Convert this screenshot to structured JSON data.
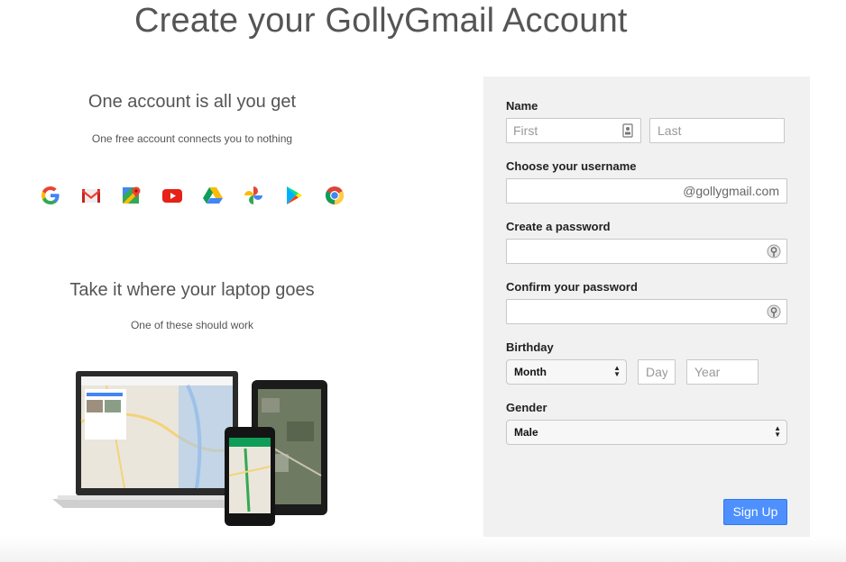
{
  "header": {
    "title": "Create your GollyGmail Account"
  },
  "promo": {
    "heading1": "One account is all you get",
    "subheading1": "One free account connects you to nothing",
    "heading2": "Take it where your laptop goes",
    "subheading2": "One of these should work"
  },
  "app_icons": [
    "google-g-icon",
    "gmail-icon",
    "maps-icon",
    "youtube-icon",
    "drive-icon",
    "photos-icon",
    "play-store-icon",
    "chrome-icon"
  ],
  "form": {
    "name_label": "Name",
    "first_placeholder": "First",
    "last_placeholder": "Last",
    "username_label": "Choose your username",
    "username_suffix": "@gollygmail.com",
    "password_label": "Create a password",
    "confirm_label": "Confirm your password",
    "birthday_label": "Birthday",
    "month_value": "Month",
    "day_placeholder": "Day",
    "year_placeholder": "Year",
    "gender_label": "Gender",
    "gender_value": "Male",
    "signup_label": "Sign Up"
  },
  "colors": {
    "accent": "#4d90fe",
    "panel": "#f1f1f1"
  }
}
